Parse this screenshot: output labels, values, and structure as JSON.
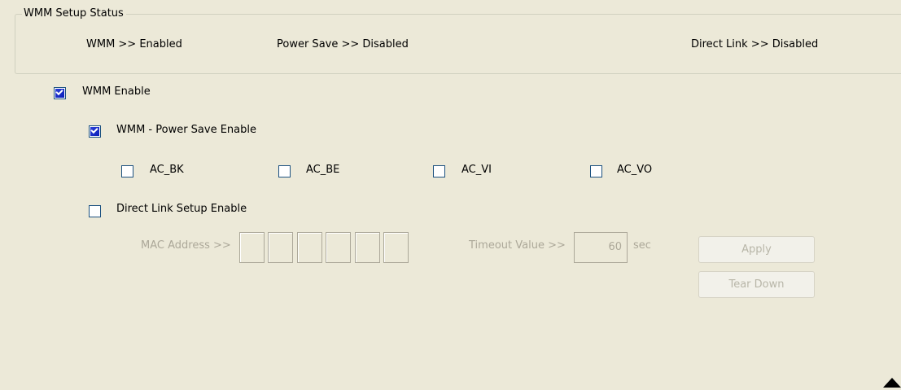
{
  "status_group": {
    "title": "WMM Setup Status",
    "wmm": "WMM >> Enabled",
    "power_save": "Power Save >> Disabled",
    "direct_link": "Direct Link >> Disabled"
  },
  "wmm_enable": {
    "label": "WMM Enable",
    "checked": true
  },
  "wmm_power_save": {
    "label": "WMM - Power Save Enable",
    "checked": true
  },
  "access_categories": [
    {
      "label": "AC_BK",
      "checked": false
    },
    {
      "label": "AC_BE",
      "checked": false
    },
    {
      "label": "AC_VI",
      "checked": false
    },
    {
      "label": "AC_VO",
      "checked": false
    }
  ],
  "direct_link_setup": {
    "label": "Direct Link Setup Enable",
    "checked": false
  },
  "mac_address": {
    "label": "MAC Address >>",
    "octets": [
      "",
      "",
      "",
      "",
      "",
      ""
    ]
  },
  "timeout": {
    "label": "Timeout Value >>",
    "value": "60",
    "unit": "sec"
  },
  "buttons": {
    "apply": "Apply",
    "tear_down": "Tear Down"
  },
  "colors": {
    "background": "#ece9d8",
    "checkbox_fill": "#0c1fb8",
    "disabled_text": "#aca899"
  }
}
